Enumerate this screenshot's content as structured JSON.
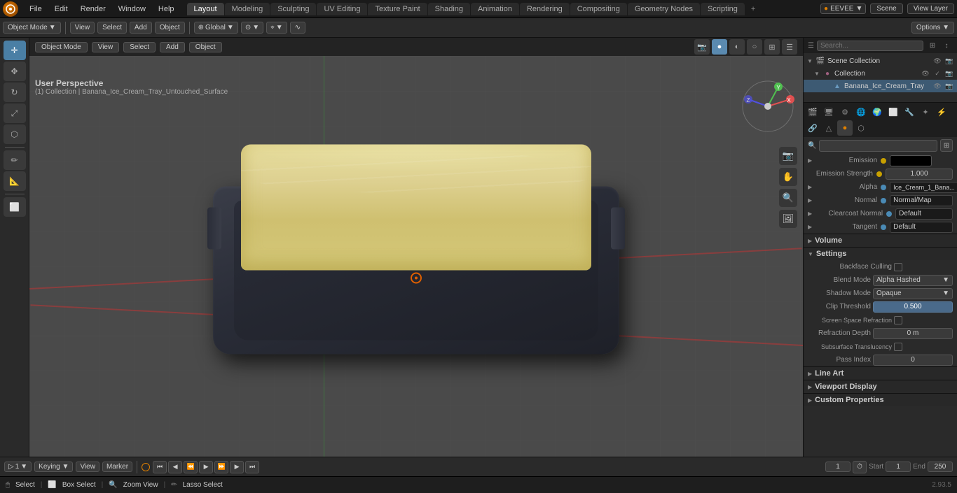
{
  "app": {
    "version": "2.93.5"
  },
  "top_menu": {
    "items": [
      "File",
      "Edit",
      "Render",
      "Window",
      "Help"
    ],
    "workspaces": [
      "Layout",
      "Modeling",
      "Sculpting",
      "UV Editing",
      "Texture Paint",
      "Shading",
      "Animation",
      "Rendering",
      "Compositing",
      "Geometry Nodes",
      "Scripting"
    ],
    "active_workspace": "Layout",
    "engine": "EEVEE",
    "scene": "Scene",
    "view_layer": "View Layer"
  },
  "viewport": {
    "object_mode": "Object Mode",
    "view_name": "User Perspective",
    "collection_path": "(1) Collection | Banana_Ice_Cream_Tray_Untouched_Surface",
    "transform_global": "Global",
    "header_buttons": [
      "Object Mode",
      "View",
      "Select",
      "Add",
      "Object"
    ]
  },
  "outliner": {
    "scene_collection": "Scene Collection",
    "items": [
      {
        "name": "Collection",
        "type": "collection",
        "expanded": true
      },
      {
        "name": "Banana_Ice_Cream_Tray",
        "type": "mesh",
        "indent": 2
      }
    ]
  },
  "properties": {
    "active_tab": "material",
    "search_placeholder": "",
    "tabs": [
      "scene",
      "render",
      "output",
      "view_layer",
      "scene2",
      "world",
      "object",
      "modifiers",
      "particles",
      "physics",
      "constraints",
      "object_data",
      "material",
      "shader"
    ],
    "fields": {
      "emission_label": "Emission",
      "emission_color": "#000000",
      "emission_strength_label": "Emission Strength",
      "emission_strength_value": "1.000",
      "alpha_label": "Alpha",
      "alpha_texture": "Ice_Cream_1_Bana...",
      "normal_label": "Normal",
      "normal_value": "Normal/Map",
      "clearcoat_normal_label": "Clearcoat Normal",
      "clearcoat_normal_value": "Default",
      "tangent_label": "Tangent",
      "tangent_value": "Default",
      "volume_label": "Volume",
      "settings_label": "Settings",
      "backface_culling_label": "Backface Culling",
      "blend_mode_label": "Blend Mode",
      "blend_mode_value": "Alpha Hashed",
      "shadow_mode_label": "Shadow Mode",
      "shadow_mode_value": "Opaque",
      "clip_threshold_label": "Clip Threshold",
      "clip_threshold_value": "0.500",
      "screen_space_refraction_label": "Screen Space Refraction",
      "refraction_depth_label": "Refraction Depth",
      "refraction_depth_value": "0 m",
      "subsurface_translucency_label": "Subsurface Translucency",
      "pass_index_label": "Pass Index",
      "pass_index_value": "0",
      "line_art_label": "Line Art",
      "viewport_display_label": "Viewport Display",
      "custom_properties_label": "Custom Properties"
    }
  },
  "timeline": {
    "start": "1",
    "end": "250",
    "current": "1",
    "start_label": "Start",
    "end_label": "End"
  },
  "bottom_status": {
    "select": "Select",
    "box_select": "Box Select",
    "zoom_view": "Zoom View",
    "lasso_select": "Lasso Select"
  }
}
